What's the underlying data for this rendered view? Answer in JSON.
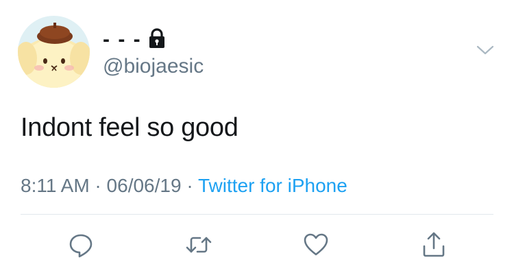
{
  "user": {
    "display_name": "- - -",
    "handle": "@biojaesic",
    "avatar_icon": "pompompurin-avatar",
    "protected_icon": "lock-icon"
  },
  "tweet": {
    "text": "Indont feel so good",
    "time": "8:11 AM",
    "separator_1": " · ",
    "date": "06/06/19",
    "separator_2": " · ",
    "source": "Twitter for iPhone"
  },
  "actions": [
    {
      "name": "reply",
      "icon": "reply-icon"
    },
    {
      "name": "retweet",
      "icon": "retweet-icon"
    },
    {
      "name": "like",
      "icon": "heart-icon"
    },
    {
      "name": "share",
      "icon": "share-icon"
    }
  ],
  "colors": {
    "text": "#14171a",
    "secondary": "#657786",
    "link": "#1da1f2",
    "divider": "#e1e8ed"
  }
}
